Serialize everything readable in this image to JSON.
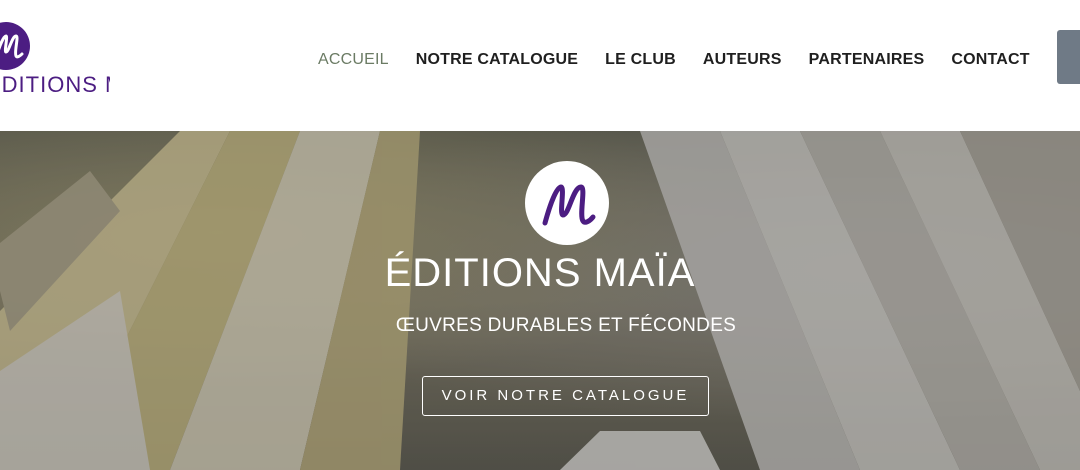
{
  "brand": {
    "logo_text": "ÉDITIONS MAÏA",
    "logo_letter": "M",
    "accent": "#4c1d82"
  },
  "nav": {
    "items": [
      {
        "label": "ACCUEIL",
        "active": true
      },
      {
        "label": "NOTRE CATALOGUE",
        "active": false
      },
      {
        "label": "LE CLUB",
        "active": false
      },
      {
        "label": "AUTEURS",
        "active": false
      },
      {
        "label": "PARTENAIRES",
        "active": false
      },
      {
        "label": "CONTACT",
        "active": false
      }
    ],
    "active_color": "#6b7b64"
  },
  "hero": {
    "title": "ÉDITIONS  MAÏA",
    "subtitle": "ŒUVRES DURABLES ET FÉCONDES",
    "cta_label": "VOIR NOTRE CATALOGUE",
    "background": "open-book-photo"
  }
}
